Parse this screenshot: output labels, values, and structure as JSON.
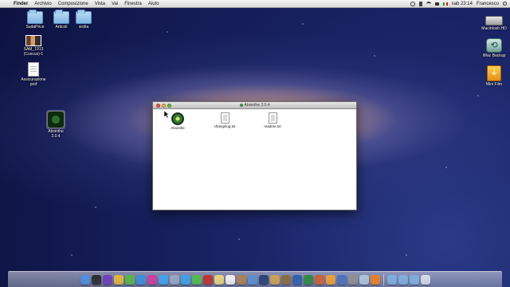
{
  "menubar": {
    "apple_glyph": "",
    "items": [
      "Finder",
      "Archivio",
      "Composizione",
      "Vista",
      "Vai",
      "Finestra",
      "Aiuto"
    ],
    "clock": "sab 23:14",
    "user": "Francesco"
  },
  "desktop_left": [
    {
      "label": "SudaPrice",
      "icon": "folder-icon"
    },
    {
      "label": "Articoli",
      "icon": "folder-icon"
    },
    {
      "label": "sicilia",
      "icon": "folder-icon"
    },
    {
      "label": "SAM_1913",
      "label2": "(Cuscus)-1",
      "icon": "photo-icon"
    },
    {
      "label": "Assicurazione",
      "label2": "prof",
      "icon": "document-icon"
    },
    {
      "label": "Absinthe",
      "label2": "2.0.4",
      "icon": "disk-image-icon"
    }
  ],
  "desktop_right": [
    {
      "label": "Macintosh HD",
      "icon": "hard-drive-icon"
    },
    {
      "label": "iMac Backup",
      "icon": "time-machine-icon"
    },
    {
      "label": "Mini Film",
      "icon": "usb-drive-icon"
    }
  ],
  "window": {
    "title": "Absinthe 2.0.4",
    "files": [
      {
        "label": "Absinthe",
        "icon": "absinthe-app-icon"
      },
      {
        "label": "changelog.txt",
        "icon": "text-file-icon"
      },
      {
        "label": "readme.txt",
        "icon": "text-file-icon"
      }
    ]
  },
  "dock": {
    "icons": [
      "finder-icon",
      "dashboard-icon",
      "mission-control-icon",
      "chrome-icon",
      "utorrent-icon",
      "safari-icon",
      "itunes-icon",
      "app-store-icon",
      "mail-icon",
      "skype-icon",
      "messages-icon",
      "photo-booth-icon",
      "notes-icon",
      "calendar-icon",
      "address-book-icon",
      "iphoto-icon",
      "photoshop-icon",
      "preview-icon",
      "garageband-icon",
      "word-icon",
      "excel-icon",
      "powerpoint-icon",
      "pages-icon",
      "xcode-icon",
      "system-preferences-icon",
      "image-capture-icon",
      "vlc-icon",
      "folder-applications-icon",
      "folder-documents-icon",
      "folder-downloads-icon",
      "trash-icon"
    ],
    "colors": [
      "#4d8fe0",
      "#2a2a2a",
      "#6d3fbf",
      "#e2b737",
      "#55b848",
      "#3b8fe0",
      "#d33ba0",
      "#3aa4f0",
      "#9aa8c4",
      "#3aa4e8",
      "#4ec04a",
      "#c0302f",
      "#e8d77a",
      "#f2f2f2",
      "#b08050",
      "#5b8fd0",
      "#2a3f73",
      "#cfa34d",
      "#8a6a3a",
      "#2f5fad",
      "#2d8a3e",
      "#d0602e",
      "#f0a030",
      "#4a70c0",
      "#909090",
      "#b0c6dc",
      "#f08020",
      "#7fb0e0",
      "#7fb0e0",
      "#7fb0e0",
      "#d8dde6"
    ]
  }
}
